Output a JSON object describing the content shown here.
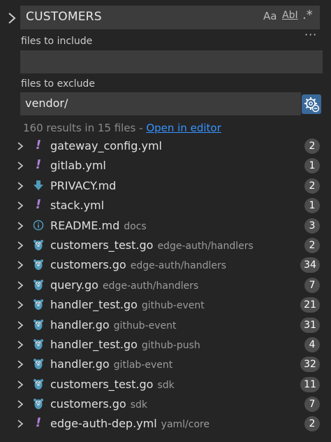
{
  "search": {
    "query": "CUSTOMERS",
    "match_case_label": "Aa",
    "whole_word_label": "AbI",
    "regex_label": ".*",
    "more_label": "···"
  },
  "includes": {
    "label": "files to include",
    "value": ""
  },
  "excludes": {
    "label": "files to exclude",
    "value": "vendor/"
  },
  "summary": {
    "text": "160 results in 15 files - ",
    "link": "Open in editor"
  },
  "colors": {
    "accent": "#3794ff",
    "yaml": "#b180d7",
    "go": "#519aba",
    "markdown": "#519aba"
  },
  "results": [
    {
      "name": "gateway_config.yml",
      "dir": "",
      "count": "2",
      "icon": "yaml-warning-icon"
    },
    {
      "name": "gitlab.yml",
      "dir": "",
      "count": "1",
      "icon": "yaml-warning-icon"
    },
    {
      "name": "PRIVACY.md",
      "dir": "",
      "count": "2",
      "icon": "markdown-icon"
    },
    {
      "name": "stack.yml",
      "dir": "",
      "count": "1",
      "icon": "yaml-warning-icon"
    },
    {
      "name": "README.md",
      "dir": "docs",
      "count": "3",
      "icon": "info-icon"
    },
    {
      "name": "customers_test.go",
      "dir": "edge-auth/handlers",
      "count": "2",
      "icon": "go-gopher-icon"
    },
    {
      "name": "customers.go",
      "dir": "edge-auth/handlers",
      "count": "34",
      "icon": "go-gopher-icon"
    },
    {
      "name": "query.go",
      "dir": "edge-auth/handlers",
      "count": "7",
      "icon": "go-gopher-icon"
    },
    {
      "name": "handler_test.go",
      "dir": "github-event",
      "count": "21",
      "icon": "go-gopher-icon"
    },
    {
      "name": "handler.go",
      "dir": "github-event",
      "count": "31",
      "icon": "go-gopher-icon"
    },
    {
      "name": "handler_test.go",
      "dir": "github-push",
      "count": "4",
      "icon": "go-gopher-icon"
    },
    {
      "name": "handler.go",
      "dir": "gitlab-event",
      "count": "32",
      "icon": "go-gopher-icon"
    },
    {
      "name": "customers_test.go",
      "dir": "sdk",
      "count": "11",
      "icon": "go-gopher-icon"
    },
    {
      "name": "customers.go",
      "dir": "sdk",
      "count": "7",
      "icon": "go-gopher-icon"
    },
    {
      "name": "edge-auth-dep.yml",
      "dir": "yaml/core",
      "count": "2",
      "icon": "yaml-warning-icon"
    }
  ]
}
